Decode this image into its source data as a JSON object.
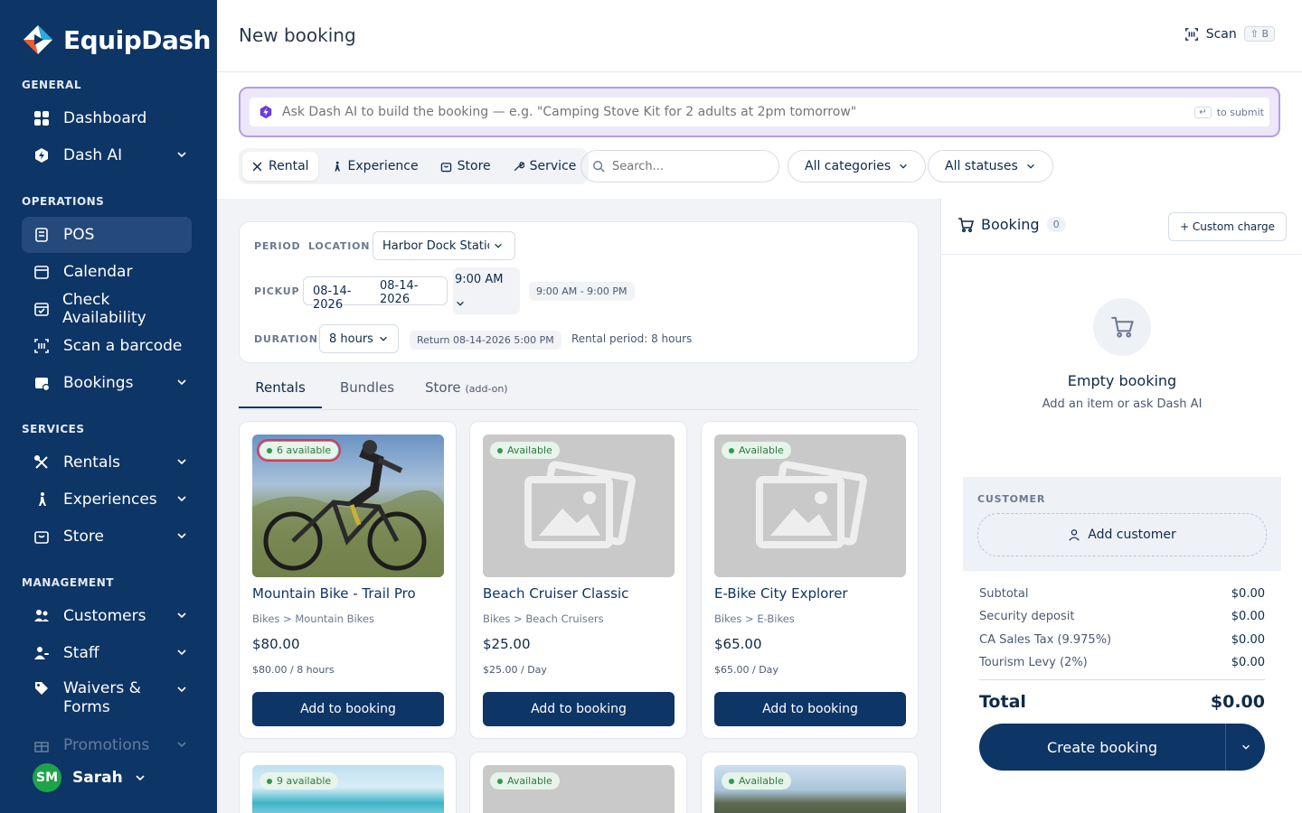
{
  "app": {
    "name": "EquipDash"
  },
  "sidebar": {
    "sections": {
      "general": "GENERAL",
      "operations": "OPERATIONS",
      "services": "SERVICES",
      "management": "MANAGEMENT"
    },
    "items": {
      "dashboard": "Dashboard",
      "dash_ai": "Dash AI",
      "pos": "POS",
      "calendar": "Calendar",
      "check_availability": "Check Availability",
      "scan_barcode": "Scan a barcode",
      "bookings": "Bookings",
      "rentals": "Rentals",
      "experiences": "Experiences",
      "store": "Store",
      "customers": "Customers",
      "staff": "Staff",
      "waivers_line1": "Waivers &",
      "waivers_line2": "Forms",
      "promotions": "Promotions"
    },
    "user": {
      "initials": "SM",
      "name": "Sarah"
    }
  },
  "header": {
    "title": "New booking",
    "scan_label": "Scan",
    "scan_shortcut": "⇧ B"
  },
  "ai_bar": {
    "placeholder": "Ask Dash AI to build the booking — e.g. \"Camping Stove Kit for 2 adults at 2pm tomorrow\"",
    "hint_key": "↵",
    "hint_text": "to submit"
  },
  "type_tabs": [
    "Rental",
    "Experience",
    "Store",
    "Service"
  ],
  "search": {
    "placeholder": "Search..."
  },
  "filters": {
    "categories": "All categories",
    "statuses": "All statuses"
  },
  "period": {
    "period_label": "PERIOD",
    "location_label": "LOCATION",
    "location_value": "Harbor Dock Station",
    "pickup_label": "PICKUP",
    "pickup_date": "08-14-2026",
    "pickup_date_overlay": "08-14-2026",
    "pickup_time": "9:00 AM",
    "hours_chip": "9:00 AM - 9:00 PM",
    "duration_label": "DURATION",
    "duration_value": "8 hours",
    "return_chip": "Return 08-14-2026 5:00 PM",
    "rental_period": "Rental period: 8 hours"
  },
  "item_tabs": {
    "rentals": "Rentals",
    "bundles": "Bundles",
    "store": "Store",
    "store_sub": "(add-on)"
  },
  "products": [
    {
      "badge": "6 available",
      "name": "Mountain Bike - Trail Pro",
      "category": "Bikes > Mountain Bikes",
      "price": "$80.00",
      "rate": "$80.00 / 8 hours",
      "button": "Add to booking"
    },
    {
      "badge": "Available",
      "name": "Beach Cruiser Classic",
      "category": "Bikes > Beach Cruisers",
      "price": "$25.00",
      "rate": "$25.00 / Day",
      "button": "Add to booking"
    },
    {
      "badge": "Available",
      "name": "E-Bike City Explorer",
      "category": "Bikes > E-Bikes",
      "price": "$65.00",
      "rate": "$65.00 / Day",
      "button": "Add to booking"
    },
    {
      "badge": "9 available"
    },
    {
      "badge": "Available"
    },
    {
      "badge": "Available"
    }
  ],
  "booking": {
    "title": "Booking",
    "count": "0",
    "custom_charge": "+ Custom charge",
    "empty_title": "Empty booking",
    "empty_sub": "Add an item or ask Dash AI",
    "customer_label": "CUSTOMER",
    "add_customer": "Add customer",
    "summary": [
      {
        "label": "Subtotal",
        "value": "$0.00"
      },
      {
        "label": "Security deposit",
        "value": "$0.00"
      },
      {
        "label": "CA Sales Tax (9.975%)",
        "value": "$0.00"
      },
      {
        "label": "Tourism Levy (2%)",
        "value": "$0.00"
      }
    ],
    "total_label": "Total",
    "total_value": "$0.00",
    "create_label": "Create booking"
  },
  "colors": {
    "sidebar": "#0d3566",
    "accent": "#0d3566",
    "available": "#2f9a4c",
    "ai_border": "#b39ee8",
    "alert": "#d83a52"
  }
}
